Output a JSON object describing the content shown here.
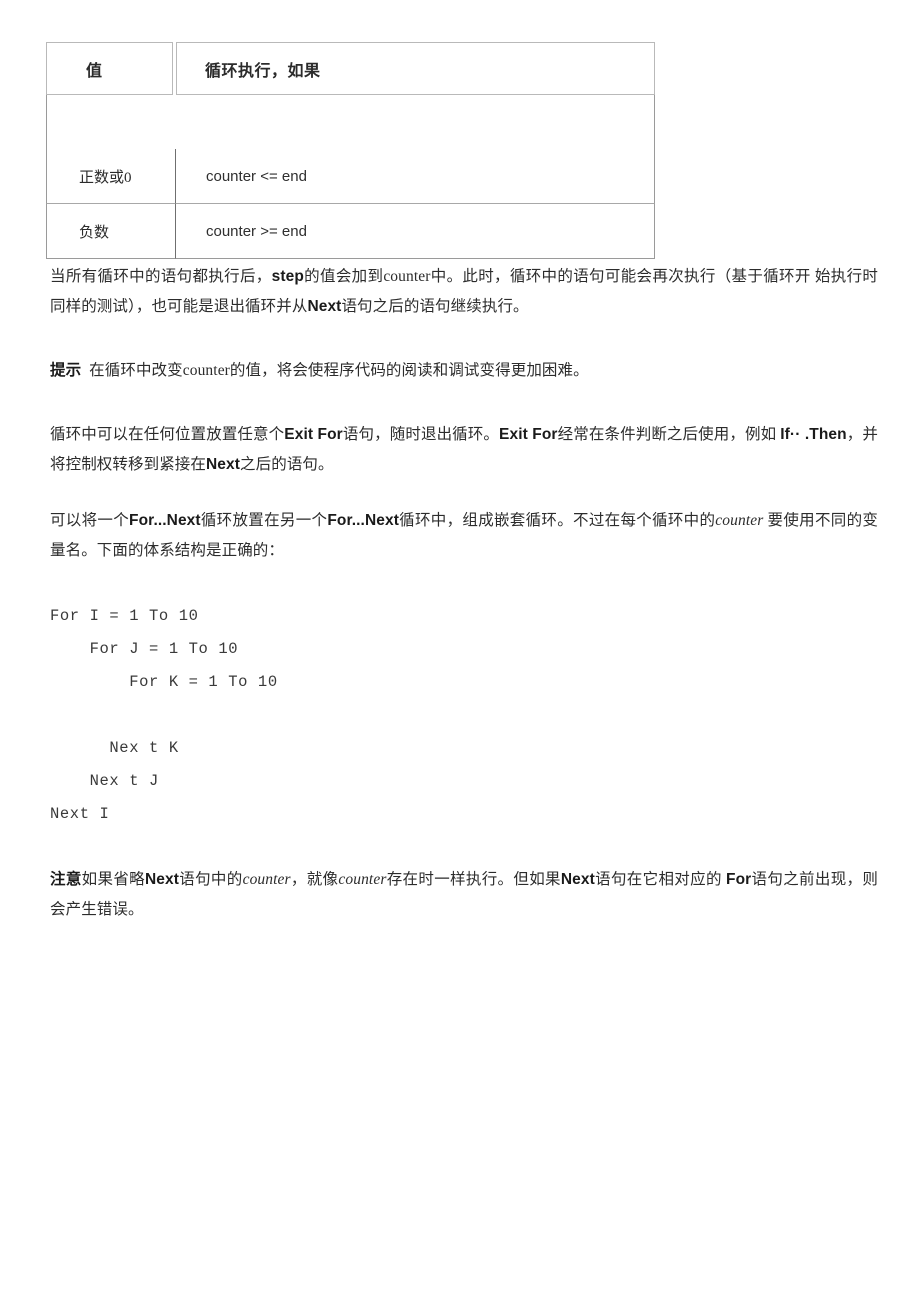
{
  "table": {
    "columns": [
      "值",
      "循环执行，如果"
    ],
    "rows": [
      {
        "value": "正数或0",
        "condition": "counter <= end"
      },
      {
        "value": "负数",
        "condition": "counter >= end"
      }
    ]
  },
  "paragraphs": {
    "p1": {
      "seg1": "当所有循环中的语句都执行后，",
      "bold1": "step",
      "seg2": "的值会加到counter中。此时，循环中的语句可能会再次执行（基于循环开 始执行时同样的测试），也可能是退出循环并从",
      "bold2": "Next",
      "seg3": "语句之后的语句继续执行。"
    },
    "p2": {
      "label": "提示",
      "text": "在循环中改变counter的值，将会使程序代码的阅读和调试变得更加困难。"
    },
    "p3": {
      "seg1": "循环中可以在任何位置放置任意个",
      "bold1": "Exit For",
      "seg2": "语句，随时退出循环。",
      "bold2": "Exit For",
      "seg3": "经常在条件判断之后使用，例如 ",
      "bold3": "If·· .Then",
      "seg4": "，并将控制权转移到紧接在",
      "bold4": "Next",
      "seg5": "之后的语句。"
    },
    "p4": {
      "seg1": "可以将一个",
      "bold1": "For...Next",
      "seg2": "循环放置在另一个",
      "bold2": "For...Next",
      "seg3": "循环中，组成嵌套循环。不过在每个循环中的",
      "italic1": "counter",
      "seg4": " 要使用不同的变量名。下面的体系结构是正确的："
    },
    "p5": {
      "label": "注意",
      "seg1": "如果省略",
      "bold1": "Next",
      "seg2": "语句中的",
      "italic1": "counter",
      "seg3": "，就像",
      "italic2": "counter",
      "seg4": "存在时一样执行。但如果",
      "bold2": "Next",
      "seg5": "语句在它相对应的 ",
      "bold3": "For",
      "seg6": "语句之前出现，则会产生错误。"
    }
  },
  "code_block": "For I = 1 To 10\n    For J = 1 To 10\n        For K = 1 To 10\n\n      Nex t K\n    Nex t J\nNext I"
}
